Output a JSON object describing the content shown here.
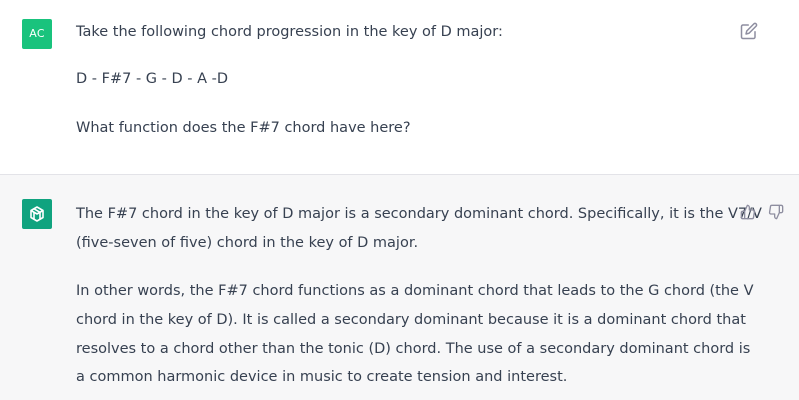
{
  "user_message": {
    "avatar_initials": "AC",
    "lines": [
      "Take the following chord progression in the key of D major:",
      "D - F#7 - G - D - A -D",
      "What function does the F#7 chord have here?"
    ]
  },
  "assistant_message": {
    "paragraph1": [
      "The F#7 chord in the key of D major is a secondary dominant chord. Specifically, it is the V7/V",
      "(five-seven of five) chord in the key of D major."
    ],
    "paragraph2": [
      "In other words, the F#7 chord functions as a dominant chord that leads to the G chord (the V",
      "chord in the key of D). It is called a secondary dominant because it is a dominant chord that",
      "resolves to a chord other than the tonic (D) chord. The use of a secondary dominant chord is",
      "a common harmonic device in music to create tension and interest."
    ]
  },
  "colors": {
    "user_avatar": "#19c37d",
    "assistant_avatar": "#10a37f",
    "text": "#374151",
    "assistant_background": "#f7f7f8"
  },
  "icons": {
    "edit": "edit-icon",
    "thumbs_up": "thumbs-up-icon",
    "thumbs_down": "thumbs-down-icon",
    "assistant_logo": "openai-logo-icon"
  }
}
